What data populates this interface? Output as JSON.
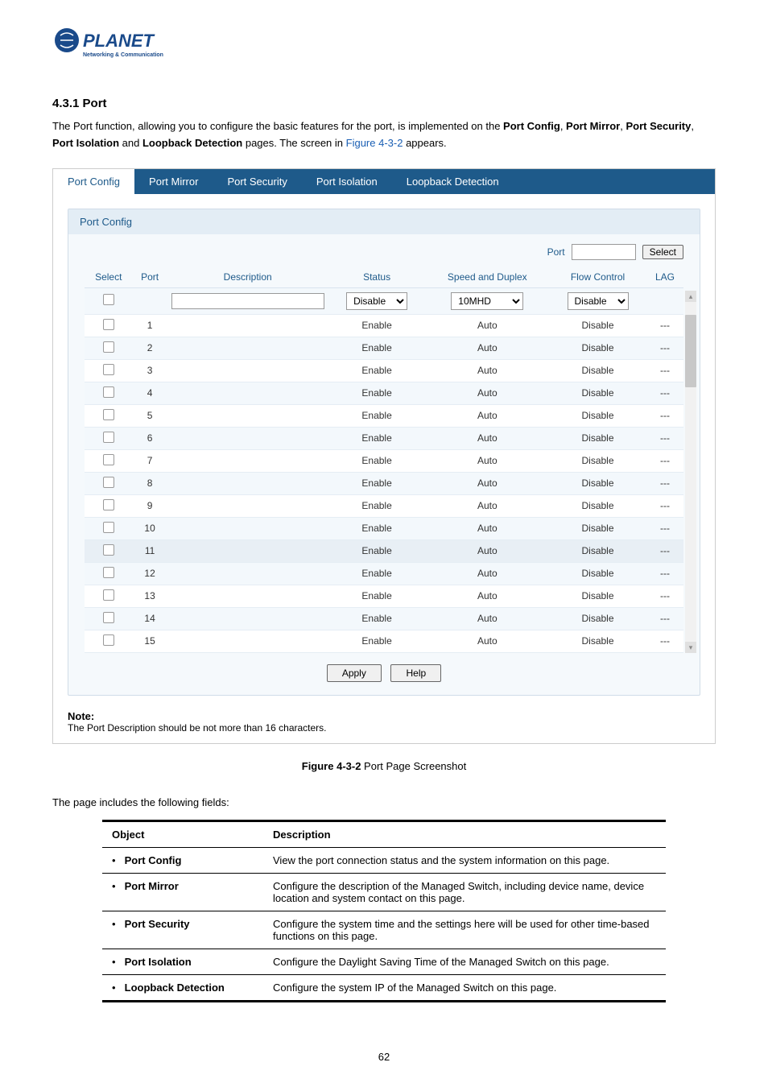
{
  "logo": {
    "brand": "PLANET",
    "tagline": "Networking & Communication"
  },
  "section_title": "4.3.1 Port",
  "intro": {
    "t1": "The Port function, allowing you to configure the basic features for the port, is implemented on the ",
    "b1": "Port Config",
    "t2": ", ",
    "b2": "Port Mirror",
    "t3": ", ",
    "b3": "Port Security",
    "t4": ", ",
    "b4": "Port Isolation",
    "t5": " and ",
    "b5": "Loopback Detection",
    "t6": " pages. The screen in ",
    "link": "Figure 4-3-2",
    "t7": " appears."
  },
  "tabs": [
    "Port Config",
    "Port Mirror",
    "Port Security",
    "Port Isolation",
    "Loopback Detection"
  ],
  "panel_header": "Port Config",
  "filter": {
    "label": "Port",
    "button": "Select"
  },
  "columns": [
    "Select",
    "Port",
    "Description",
    "Status",
    "Speed and Duplex",
    "Flow Control",
    "LAG"
  ],
  "control_row": {
    "status": "Disable",
    "speed": "10MHD",
    "flow": "Disable"
  },
  "rows": [
    {
      "port": "1",
      "status": "Enable",
      "speed": "Auto",
      "flow": "Disable",
      "lag": "---"
    },
    {
      "port": "2",
      "status": "Enable",
      "speed": "Auto",
      "flow": "Disable",
      "lag": "---"
    },
    {
      "port": "3",
      "status": "Enable",
      "speed": "Auto",
      "flow": "Disable",
      "lag": "---"
    },
    {
      "port": "4",
      "status": "Enable",
      "speed": "Auto",
      "flow": "Disable",
      "lag": "---"
    },
    {
      "port": "5",
      "status": "Enable",
      "speed": "Auto",
      "flow": "Disable",
      "lag": "---"
    },
    {
      "port": "6",
      "status": "Enable",
      "speed": "Auto",
      "flow": "Disable",
      "lag": "---"
    },
    {
      "port": "7",
      "status": "Enable",
      "speed": "Auto",
      "flow": "Disable",
      "lag": "---"
    },
    {
      "port": "8",
      "status": "Enable",
      "speed": "Auto",
      "flow": "Disable",
      "lag": "---"
    },
    {
      "port": "9",
      "status": "Enable",
      "speed": "Auto",
      "flow": "Disable",
      "lag": "---"
    },
    {
      "port": "10",
      "status": "Enable",
      "speed": "Auto",
      "flow": "Disable",
      "lag": "---"
    },
    {
      "port": "11",
      "status": "Enable",
      "speed": "Auto",
      "flow": "Disable",
      "lag": "---"
    },
    {
      "port": "12",
      "status": "Enable",
      "speed": "Auto",
      "flow": "Disable",
      "lag": "---"
    },
    {
      "port": "13",
      "status": "Enable",
      "speed": "Auto",
      "flow": "Disable",
      "lag": "---"
    },
    {
      "port": "14",
      "status": "Enable",
      "speed": "Auto",
      "flow": "Disable",
      "lag": "---"
    },
    {
      "port": "15",
      "status": "Enable",
      "speed": "Auto",
      "flow": "Disable",
      "lag": "---"
    }
  ],
  "buttons": {
    "apply": "Apply",
    "help": "Help"
  },
  "note": {
    "title": "Note:",
    "text": "The Port Description should be not more than 16 characters."
  },
  "caption": {
    "prefix": "Figure 4-3-2",
    "suffix": " Port Page Screenshot"
  },
  "fields_intro": "The page includes the following fields:",
  "fields_header": {
    "obj": "Object",
    "desc": "Description"
  },
  "fields": [
    {
      "obj": "Port Config",
      "desc": "View the port connection status and the system information on this page."
    },
    {
      "obj": "Port Mirror",
      "desc": "Configure the description of the Managed Switch, including device name, device location and system contact on this page."
    },
    {
      "obj": "Port Security",
      "desc": "Configure the system time and the settings here will be used for other time-based functions on this page."
    },
    {
      "obj": "Port Isolation",
      "desc": "Configure the Daylight Saving Time of the Managed Switch on this page."
    },
    {
      "obj": "Loopback Detection",
      "desc": "Configure the system IP of the Managed Switch on this page."
    }
  ],
  "pagenum": "62"
}
